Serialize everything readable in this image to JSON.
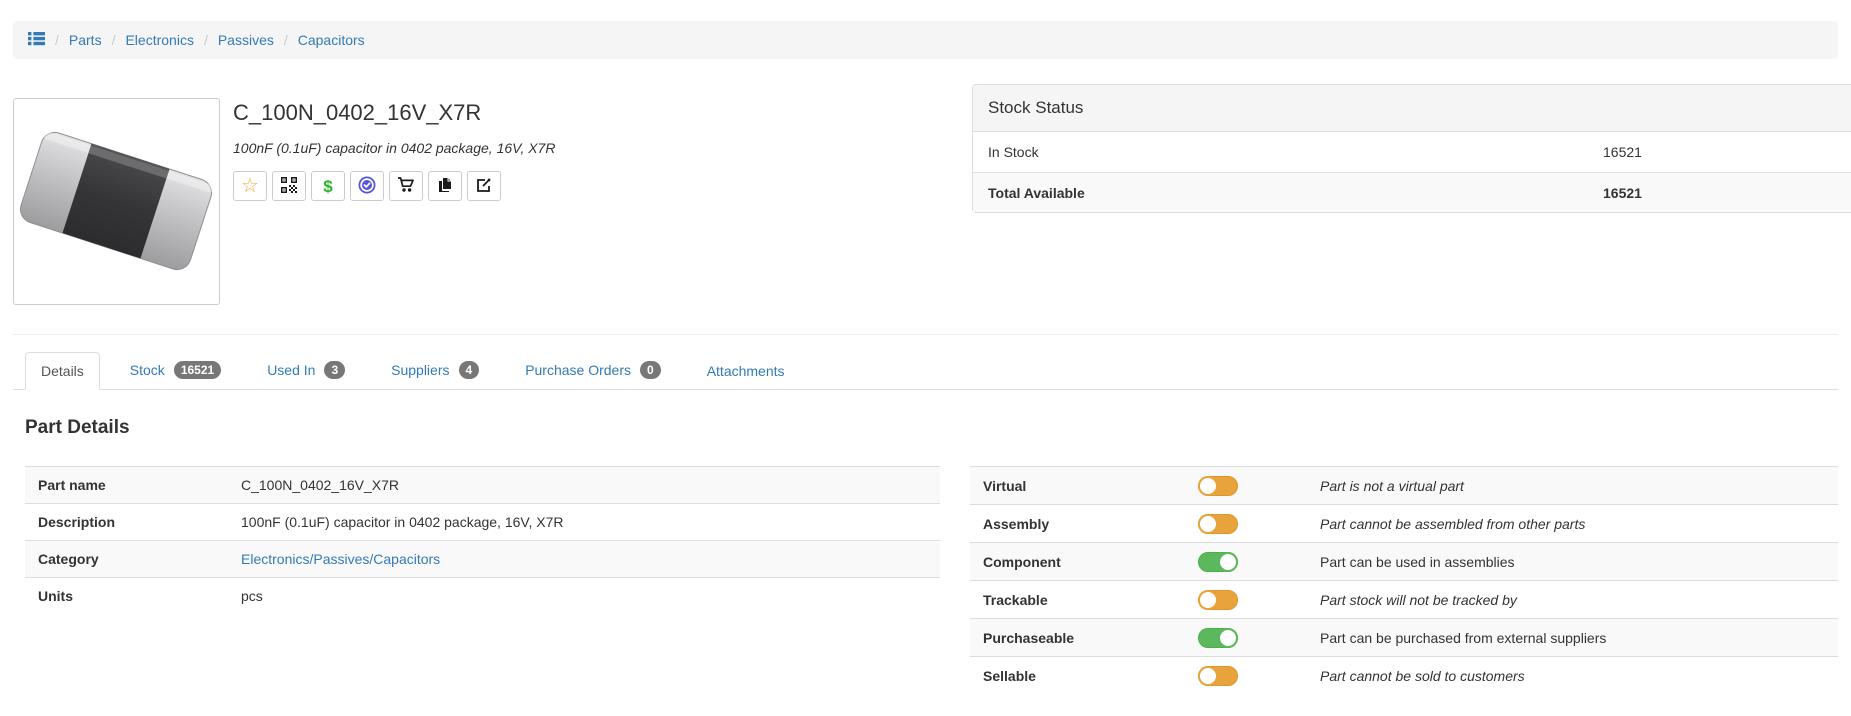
{
  "breadcrumb": {
    "home_icon": "list-icon",
    "items": [
      {
        "label": "Parts"
      },
      {
        "label": "Electronics"
      },
      {
        "label": "Passives"
      },
      {
        "label": "Capacitors"
      }
    ]
  },
  "part": {
    "name": "C_100N_0402_16V_X7R",
    "description": "100nF (0.1uF) capacitor in 0402 package, 16V, X7R",
    "image_alt": "SMD ceramic capacitor photo",
    "actions": [
      {
        "icon": "star-icon"
      },
      {
        "icon": "qr-code-icon"
      },
      {
        "icon": "dollar-icon"
      },
      {
        "icon": "check-circle-icon"
      },
      {
        "icon": "cart-icon"
      },
      {
        "icon": "copy-icon"
      },
      {
        "icon": "edit-icon"
      }
    ]
  },
  "stock_panel": {
    "title": "Stock Status",
    "rows": [
      {
        "label": "In Stock",
        "value": "16521"
      },
      {
        "label": "Total Available",
        "value": "16521"
      }
    ]
  },
  "tabs": [
    {
      "label": "Details",
      "active": true
    },
    {
      "label": "Stock",
      "badge": "16521"
    },
    {
      "label": "Used In",
      "badge": "3"
    },
    {
      "label": "Suppliers",
      "badge": "4"
    },
    {
      "label": "Purchase Orders",
      "badge": "0"
    },
    {
      "label": "Attachments"
    }
  ],
  "details": {
    "heading": "Part Details",
    "left_rows": [
      {
        "label": "Part name",
        "value": "C_100N_0402_16V_X7R"
      },
      {
        "label": "Description",
        "value": "100nF (0.1uF) capacitor in 0402 package, 16V, X7R"
      },
      {
        "label": "Category",
        "value": "Electronics/Passives/Capacitors"
      },
      {
        "label": "Units",
        "value": "pcs"
      }
    ],
    "flags": [
      {
        "label": "Virtual",
        "state": "off",
        "tone": "negative",
        "text": "Part is not a virtual part"
      },
      {
        "label": "Assembly",
        "state": "off",
        "tone": "negative",
        "text": "Part cannot be assembled from other parts"
      },
      {
        "label": "Component",
        "state": "on",
        "tone": "positive",
        "text": "Part can be used in assemblies"
      },
      {
        "label": "Trackable",
        "state": "off",
        "tone": "negative",
        "text": "Part stock will not be tracked by"
      },
      {
        "label": "Purchaseable",
        "state": "on",
        "tone": "positive",
        "text": "Part can be purchased from external suppliers"
      },
      {
        "label": "Sellable",
        "state": "off",
        "tone": "negative",
        "text": "Part cannot be sold to customers"
      }
    ]
  },
  "colors": {
    "link": "#337ab7",
    "toggle_on": "#5cb85c",
    "toggle_off": "#e8a33d",
    "badge": "#777777",
    "star": "#f5a832",
    "dollar": "#28b62c",
    "check_circle": "#5654d8",
    "panel_heading_bg": "#f5f5f5",
    "stripe_bg": "#f9f9f9"
  }
}
